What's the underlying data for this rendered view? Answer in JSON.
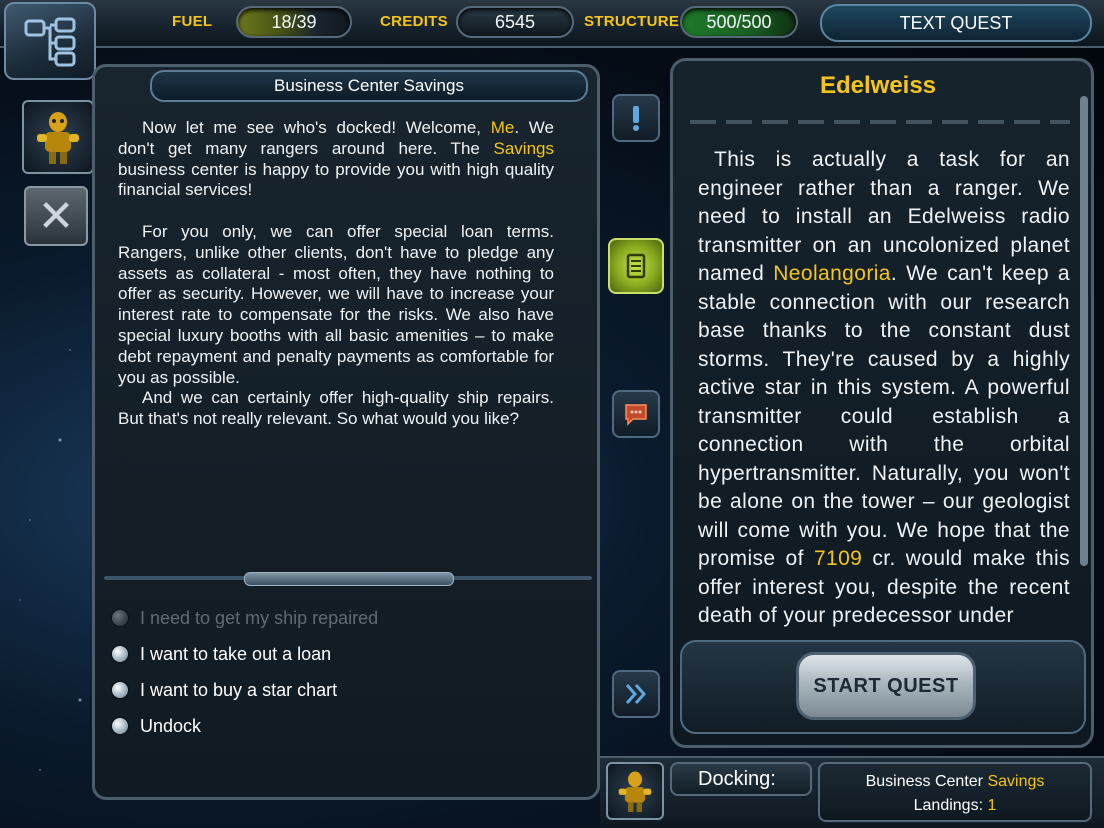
{
  "stats": {
    "fuel_label": "FUEL",
    "fuel_value": "18/39",
    "credits_label": "CREDITS",
    "credits_value": "6545",
    "structure_label": "STRUCTURE",
    "structure_value": "500/500"
  },
  "tabs": {
    "text_quest": "TEXT QUEST"
  },
  "dialog": {
    "title": "Business Center Savings",
    "p1_a": "Now let me see who's docked! Welcome, ",
    "p1_name": "Me",
    "p1_b": ". We don't get many rangers around here. The ",
    "p1_center": "Savings",
    "p1_c": " business center is happy to provide you with high quality financial services!",
    "p2": "For you only, we can offer special loan terms. Rangers, unlike other clients, don't have to pledge any assets as collateral - most often, they have nothing to offer as security. However, we will have to increase your interest rate to compensate for the risks. We also have special luxury booths with all basic amenities – to make debt repayment and penalty payments as comfortable for you as possible.",
    "p3": "And we can certainly offer high-quality ship repairs. But that's not really relevant. So what would you like?"
  },
  "options": [
    {
      "label": "I need to get my ship repaired",
      "enabled": false
    },
    {
      "label": "I want to take out a loan",
      "enabled": true
    },
    {
      "label": "I want to buy a star chart",
      "enabled": true
    },
    {
      "label": "Undock",
      "enabled": true
    }
  ],
  "quest": {
    "title": "Edelweiss",
    "text_a": "This is actually a task for an engineer rather than a ranger. We need to install an Edelweiss radio transmitter on an uncolonized planet named ",
    "planet": "Neolangoria",
    "text_b": ". We can't keep a stable connection with our research base thanks to the constant dust storms. They're caused by a highly active star in this system. A powerful transmitter could establish a connection with the orbital hypertransmitter. Naturally, you won't be alone on the tower – our geologist will come with you. We hope that the promise of ",
    "reward": "7109",
    "text_c": " cr. would make this offer interest you, despite the recent death of your predecessor under",
    "start_label": "START QUEST"
  },
  "status": {
    "docking_label": "Docking:",
    "location_prefix": "Business Center ",
    "location_name": "Savings",
    "landings_label": "Landings: ",
    "landings_value": "1"
  },
  "colors": {
    "accent": "#f5c518",
    "fuel_fill": "#6e7a1c",
    "structure_fill": "#1f7a2a"
  }
}
